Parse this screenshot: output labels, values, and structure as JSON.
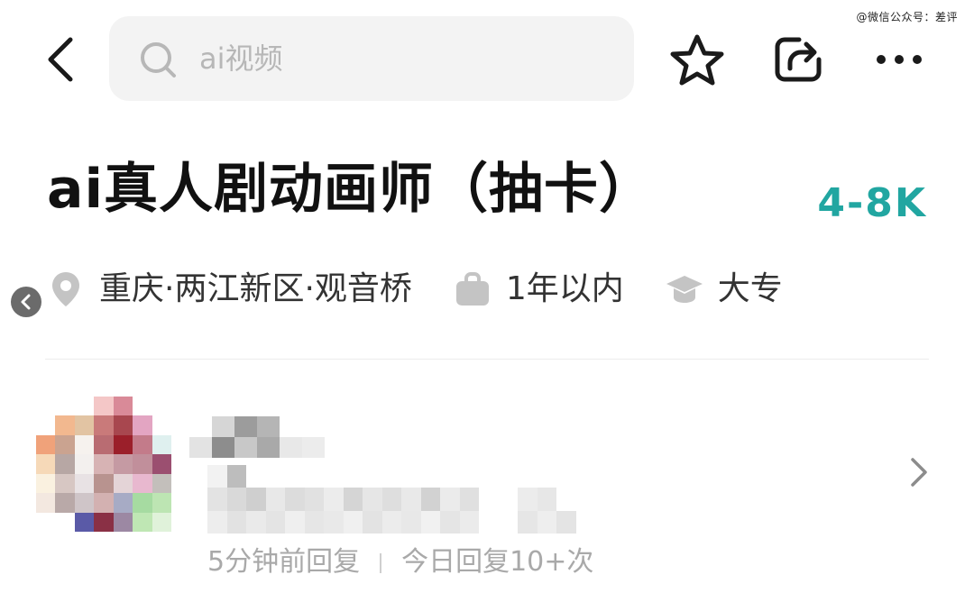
{
  "watermark": "@微信公众号：差评",
  "search": {
    "placeholder": "ai视频"
  },
  "job": {
    "title": "ai真人剧动画师（抽卡）",
    "salary": "4-8K"
  },
  "info": {
    "location": "重庆·两江新区·观音桥",
    "experience": "1年以内",
    "education": "大专"
  },
  "recruiter": {
    "reply_time": "5分钟前回复",
    "reply_count": "今日回复10+次"
  },
  "colors": {
    "accent": "#21a6a1",
    "search_bg": "#f3f3f3",
    "text_primary": "#111111",
    "text_secondary": "#333333",
    "text_muted": "#a9a9a9",
    "icon_gray": "#c4c4c4"
  },
  "icons": {
    "back": "chevron-left-icon",
    "search": "search-icon",
    "favorite": "star-icon",
    "share": "share-icon",
    "more": "more-dots-icon",
    "location": "location-pin-icon",
    "experience": "briefcase-icon",
    "education": "graduation-cap-icon",
    "collapse": "chevron-left-icon",
    "open": "chevron-right-icon"
  }
}
